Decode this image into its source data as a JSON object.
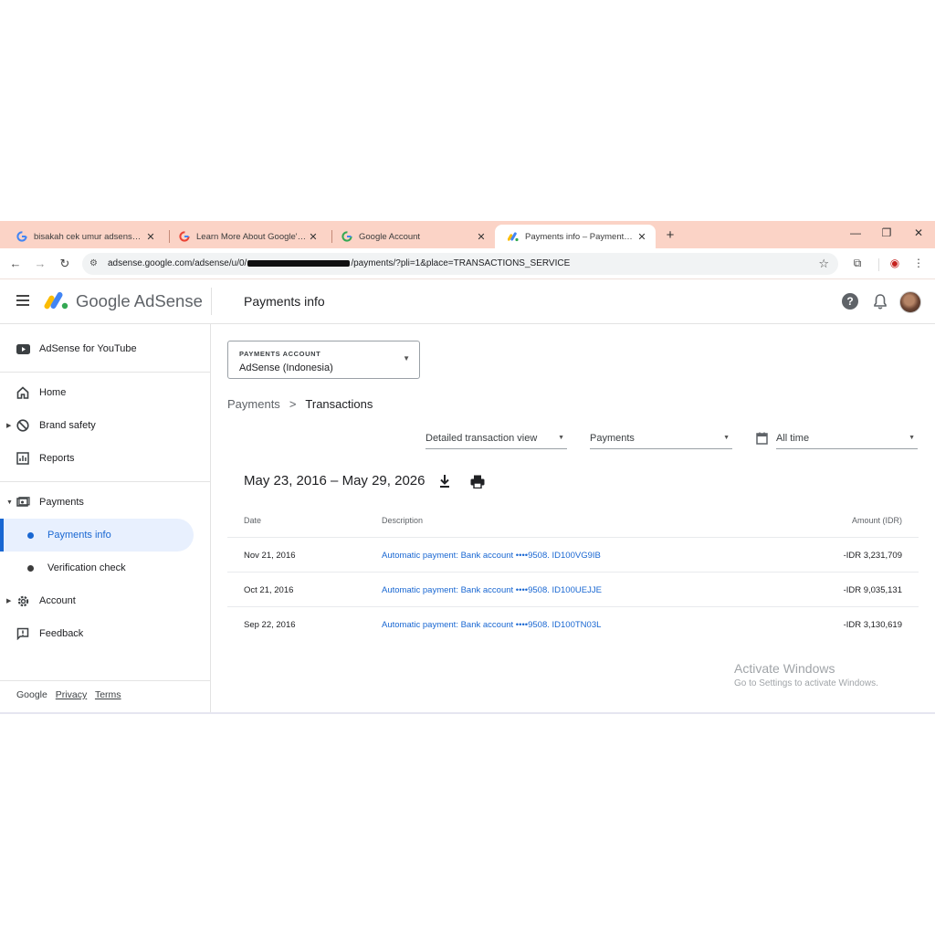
{
  "browser": {
    "tabs": [
      {
        "title": "bisakah cek umur adsense - Go",
        "active": false,
        "favicon": "google-g-icon"
      },
      {
        "title": "Learn More About Google's Sec",
        "active": false,
        "favicon": "google-g-icon"
      },
      {
        "title": "Google Account",
        "active": false,
        "favicon": "google-g-icon"
      },
      {
        "title": "Payments info – Payments – Go",
        "active": true,
        "favicon": "adsense-icon"
      }
    ],
    "url_prefix": "adsense.google.com/adsense/u/0/",
    "url_suffix": "/payments/?pli=1&place=TRANSACTIONS_SERVICE"
  },
  "header": {
    "app_name_google": "Google",
    "app_name_product": "AdSense",
    "page_title": "Payments info",
    "help_glyph": "?"
  },
  "sidebar": {
    "items": [
      {
        "label": "AdSense for YouTube",
        "icon": "youtube-icon"
      },
      {
        "label": "Home",
        "icon": "home-icon"
      },
      {
        "label": "Brand safety",
        "icon": "block-icon"
      },
      {
        "label": "Reports",
        "icon": "bar-chart-icon"
      },
      {
        "label": "Payments",
        "icon": "payments-icon"
      },
      {
        "label": "Payments info"
      },
      {
        "label": "Verification check"
      },
      {
        "label": "Account",
        "icon": "gear-icon"
      },
      {
        "label": "Feedback",
        "icon": "feedback-icon"
      }
    ],
    "footer": {
      "google": "Google",
      "privacy": "Privacy",
      "terms": "Terms"
    }
  },
  "main": {
    "account_select": {
      "label": "PAYMENTS ACCOUNT",
      "value": "AdSense (Indonesia)"
    },
    "breadcrumb": {
      "parent": "Payments",
      "separator": ">",
      "current": "Transactions"
    },
    "filters": {
      "view": "Detailed transaction view",
      "type": "Payments",
      "range": "All time"
    },
    "date_range": "May 23, 2016 – May 29, 2026",
    "table": {
      "headers": {
        "date": "Date",
        "description": "Description",
        "amount": "Amount (IDR)"
      },
      "rows": [
        {
          "date": "Nov 21, 2016",
          "description": "Automatic payment: Bank account ••••9508. ID100VG9IB",
          "amount": "-IDR 3,231,709"
        },
        {
          "date": "Oct 21, 2016",
          "description": "Automatic payment: Bank account ••••9508. ID100UEJJE",
          "amount": "-IDR 9,035,131"
        },
        {
          "date": "Sep 22, 2016",
          "description": "Automatic payment: Bank account ••••9508. ID100TN03L",
          "amount": "-IDR 3,130,619"
        }
      ]
    }
  },
  "watermark": {
    "line1": "Activate Windows",
    "line2": "Go to Settings to activate Windows."
  },
  "colors": {
    "accent": "#1967d2",
    "tabstrip": "#fbd3c6",
    "active_nav_bg": "#e8f0fe"
  }
}
